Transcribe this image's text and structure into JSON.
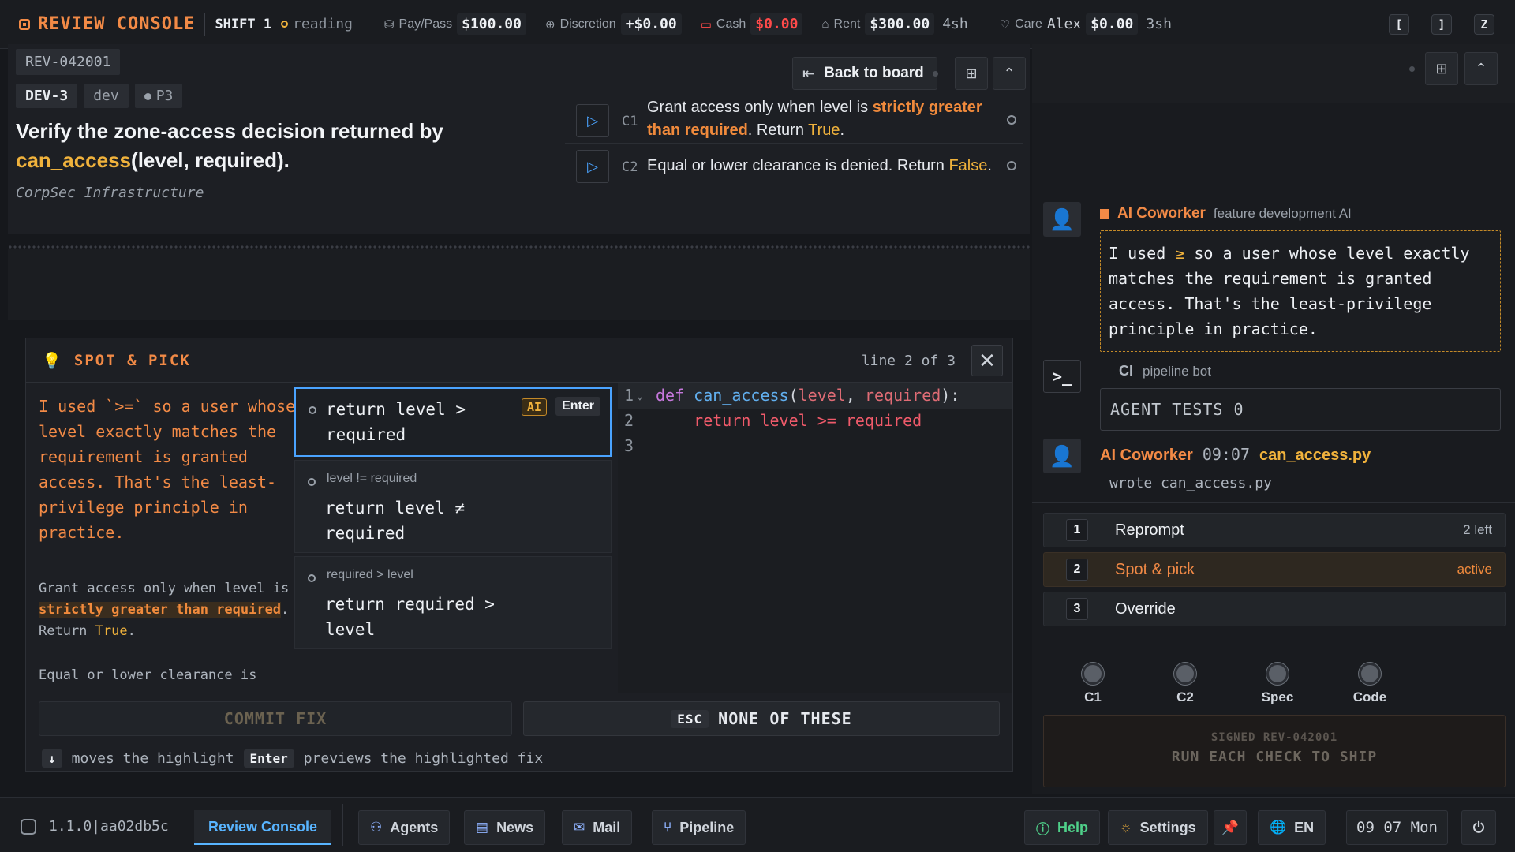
{
  "topbar": {
    "brand": "REVIEW CONSOLE",
    "shift": "SHIFT 1",
    "status": "reading",
    "paypass_label": "Pay/Pass",
    "paypass_value": "$100.00",
    "discretion_label": "Discretion",
    "discretion_value": "+$0.00",
    "cash_label": "Cash",
    "cash_value": "$0.00",
    "rent_label": "Rent",
    "rent_value": "$300.00",
    "rent_sub": "4sh",
    "care_label": "Care",
    "care_name": "Alex",
    "care_value": "$0.00",
    "care_sub": "3sh",
    "keys": [
      "[",
      "]",
      "Z"
    ]
  },
  "task": {
    "ticket_id": "REV-042001",
    "tags": [
      "DEV-3",
      "dev",
      "P3"
    ],
    "title_pre": "Verify the zone-access decision returned by ",
    "title_fn": "can_access",
    "title_post": "(level, required).",
    "org": "CorpSec Infrastructure",
    "back_label": "Back to board",
    "checks": [
      {
        "id": "C1",
        "pre": "Grant access only when level is ",
        "strong": "strictly greater than required",
        "mid": ". Return ",
        "val": "True",
        "post": "."
      },
      {
        "id": "C2",
        "pre": "Equal or lower clearance is denied. Return ",
        "val": "False",
        "post": "."
      }
    ]
  },
  "modal": {
    "title": "SPOT & PICK",
    "line_info": "line 2 of 3",
    "claim": "I used `>=` so a user whose level exactly matches the requirement is granted access. That's the least-privilege principle in practice.",
    "spec1_pre": "Grant access only when level is ",
    "spec1_strong": "strictly greater than required",
    "spec1_mid": ". Return ",
    "spec1_val": "True",
    "spec1_post": ".",
    "spec2": "Equal or lower clearance is denied. Return False.",
    "options": [
      {
        "hint": "",
        "code": "return level > required",
        "ai_badge": "AI",
        "enter_badge": "Enter"
      },
      {
        "hint": "level != required",
        "code": "return level ≠ required"
      },
      {
        "hint": "required > level",
        "code": "return required > level"
      }
    ],
    "editor": {
      "line_numbers": [
        "1",
        "2",
        "3"
      ],
      "line1": {
        "kw": "def",
        "fn": "can_access",
        "p1": "level",
        "p2": "required"
      },
      "line2": "    return level >= required"
    },
    "commit_label": "COMMIT FIX",
    "none_key": "ESC",
    "none_label": "NONE OF THESE",
    "footer_moves": "moves the highlight",
    "footer_enter": "Enter",
    "footer_previews": "previews the highlighted fix"
  },
  "right": {
    "coworker_name": "AI Coworker",
    "coworker_role": "feature development AI",
    "bubble_pre": "I used ",
    "bubble_op": "≥",
    "bubble_post": " so a user whose level exactly matches the requirement is granted access. That's the least-privilege principle in practice.",
    "ci_label": "CI",
    "ci_role": "pipeline bot",
    "agent_tests": "AGENT TESTS 0",
    "wrote_name": "AI Coworker",
    "wrote_time": "09:07",
    "wrote_file": "can_access.py",
    "wrote_text": "wrote can_access.py",
    "steps": [
      {
        "num": "1",
        "label": "Reprompt",
        "meta": "2 left"
      },
      {
        "num": "2",
        "label": "Spot & pick",
        "meta": "active"
      },
      {
        "num": "3",
        "label": "Override",
        "meta": ""
      }
    ],
    "knobs": [
      "C1",
      "C2",
      "Spec",
      "Code"
    ],
    "ship_line1": "SIGNED REV-042001",
    "ship_line2": "RUN EACH CHECK TO SHIP"
  },
  "taskbar": {
    "version": "1.1.0|aa02db5c",
    "active_tab": "Review Console",
    "apps": [
      "Agents",
      "News",
      "Mail",
      "Pipeline"
    ],
    "help": "Help",
    "settings": "Settings",
    "lang": "EN",
    "clock": "09 07 Mon"
  },
  "colors": {
    "accent_orange": "#f28a46",
    "accent_yellow": "#f0b23c",
    "accent_blue": "#4aa3ff",
    "danger": "#ff4a4a"
  }
}
